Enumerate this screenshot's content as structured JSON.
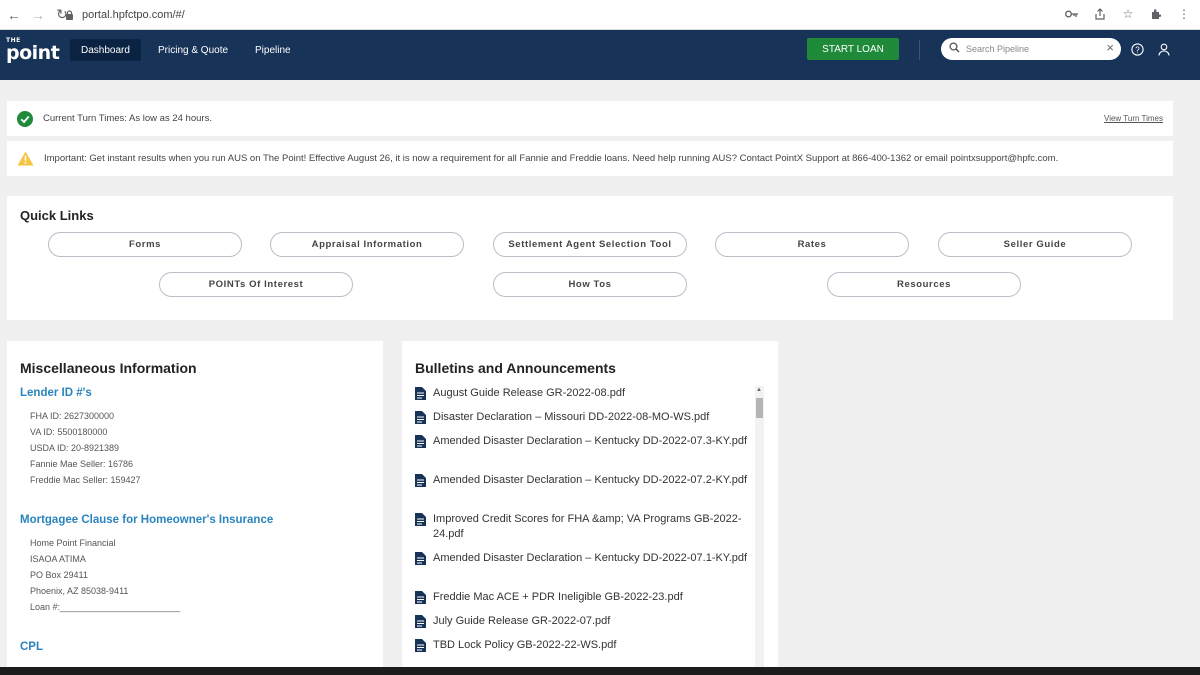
{
  "browser": {
    "url": "portal.hpfctpo.com/#/"
  },
  "header": {
    "logo_small": "THE",
    "logo_big": "point",
    "tabs": [
      {
        "label": "Dashboard",
        "active": true
      },
      {
        "label": "Pricing & Quote",
        "active": false
      },
      {
        "label": "Pipeline",
        "active": false
      }
    ],
    "start_loan": "START LOAN",
    "search_placeholder": "Search Pipeline",
    "bg_color": "#173358",
    "start_loan_color": "#1e8a3a"
  },
  "banners": {
    "turn_times": "Current Turn Times: As low as 24 hours.",
    "view_turn_times": "View Turn Times",
    "important": "Important: Get instant results when you run AUS on The Point! Effective August 26, it is now a requirement for all Fannie and Freddie loans. Need help running AUS? Contact PointX Support at 866-400-1362 or email pointxsupport@hpfc.com."
  },
  "quick_links": {
    "title": "Quick Links",
    "row1": [
      "Forms",
      "Appraisal Information",
      "Settlement Agent Selection Tool",
      "Rates",
      "Seller Guide"
    ],
    "row2": [
      "POINTs Of Interest",
      "How Tos",
      "Resources"
    ]
  },
  "misc": {
    "title": "Miscellaneous Information",
    "lender_heading": "Lender ID #'s",
    "lender_ids": [
      "FHA ID: 2627300000",
      "VA ID: 5500180000",
      "USDA ID: 20-8921389",
      "Fannie Mae Seller: 16786",
      "Freddie Mac Seller: 159427"
    ],
    "mortgagee_heading": "Mortgagee Clause for Homeowner's Insurance",
    "mortgagee_lines": [
      "Home Point Financial",
      "ISAOA ATIMA",
      "PO Box 29411",
      "Phoenix, AZ 85038-9411",
      "Loan #:________________________"
    ],
    "cpl_heading": "CPL"
  },
  "bulletins": {
    "title": "Bulletins and Announcements",
    "items": [
      "August Guide Release GR-2022-08.pdf",
      "Disaster Declaration – Missouri DD-2022-08-MO-WS.pdf",
      "Amended Disaster Declaration – Kentucky DD-2022-07.3-KY.pdf",
      "Amended Disaster Declaration – Kentucky DD-2022-07.2-KY.pdf",
      "Improved Credit Scores for FHA &amp; VA Programs GB-2022-24.pdf",
      "Amended Disaster Declaration – Kentucky DD-2022-07.1-KY.pdf",
      "Freddie Mac ACE + PDR Ineligible GB-2022-23.pdf",
      "July Guide Release GR-2022-07.pdf",
      "TBD Lock Policy GB-2022-22-WS.pdf"
    ]
  }
}
